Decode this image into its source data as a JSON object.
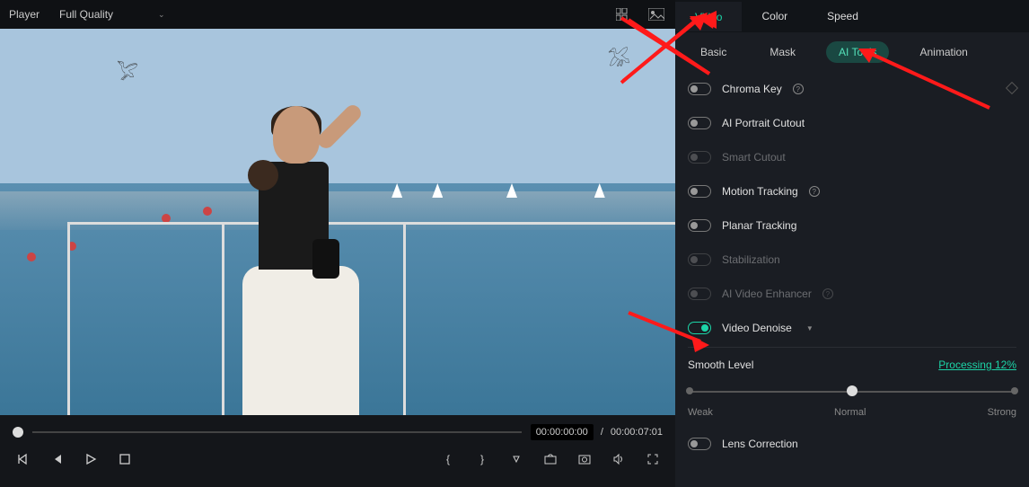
{
  "topbar": {
    "player_label": "Player",
    "quality_value": "Full Quality"
  },
  "time": {
    "current": "00:00:00:00",
    "separator": "/",
    "total": "00:00:07:01"
  },
  "primary_tabs": [
    {
      "label": "Video",
      "active": true
    },
    {
      "label": "Color",
      "active": false
    },
    {
      "label": "Speed",
      "active": false
    }
  ],
  "sub_tabs": [
    {
      "label": "Basic",
      "active": false
    },
    {
      "label": "Mask",
      "active": false
    },
    {
      "label": "AI Tools",
      "active": true
    },
    {
      "label": "Animation",
      "active": false
    }
  ],
  "options": {
    "chroma_key": "Chroma Key",
    "ai_portrait": "AI Portrait Cutout",
    "smart_cutout": "Smart Cutout",
    "motion_tracking": "Motion Tracking",
    "planar_tracking": "Planar Tracking",
    "stabilization": "Stabilization",
    "ai_video_enhancer": "AI Video Enhancer",
    "video_denoise": "Video Denoise",
    "lens_correction": "Lens Correction"
  },
  "smooth": {
    "title": "Smooth Level",
    "processing": "Processing 12%",
    "labels": {
      "weak": "Weak",
      "normal": "Normal",
      "strong": "Strong"
    }
  },
  "brace": {
    "left": "{",
    "right": "}"
  }
}
